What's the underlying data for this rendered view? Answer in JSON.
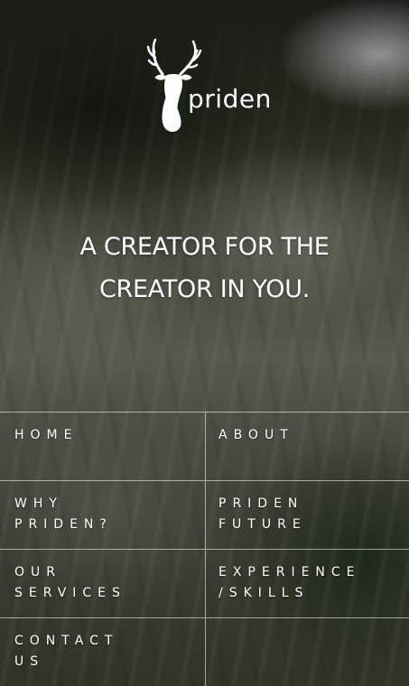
{
  "brand": {
    "logo_text": "priden",
    "trademark": ".",
    "logo_icon": "stag-head-icon"
  },
  "hero": {
    "headline_line1": "A CREATOR FOR THE",
    "headline_line2": "CREATOR IN YOU."
  },
  "nav": {
    "home": {
      "line1": "HOME"
    },
    "about": {
      "line1": "ABOUT"
    },
    "why_priden": {
      "line1": "WHY",
      "line2": "PRIDEN?"
    },
    "priden_future": {
      "line1": "PRIDEN",
      "line2": "FUTURE"
    },
    "our_services": {
      "line1": "OUR",
      "line2": "SERVICES"
    },
    "experience_skills": {
      "line1": "EXPERIENCE",
      "line2": "/SKILLS"
    },
    "contact_us": {
      "line1": "CONTACT",
      "line2": "US"
    }
  },
  "colors": {
    "text": "#ffffff",
    "divider": "rgba(255,255,255,0.55)",
    "background_dark": "#2c3226",
    "background_mid": "#6a6e5e"
  }
}
